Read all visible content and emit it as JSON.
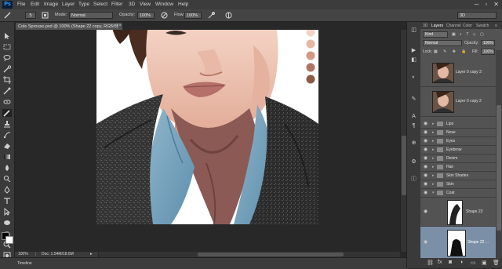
{
  "app": {
    "logo": "Ps"
  },
  "menu": [
    "File",
    "Edit",
    "Image",
    "Layer",
    "Type",
    "Select",
    "Filter",
    "3D",
    "View",
    "Window",
    "Help"
  ],
  "window_controls": [
    "─",
    "▫",
    "✕"
  ],
  "options_bar": {
    "size_value": "5",
    "mode_label": "Mode:",
    "mode_value": "Normal",
    "opacity_label": "Opacity:",
    "opacity_value": "100%",
    "flow_label": "Flow:",
    "flow_value": "100%",
    "workspace_value": "3D"
  },
  "document": {
    "tab_title": "Cole Sprouse.psd @ 100% (Shape 22 copy, RGB/8) *",
    "close_glyph": "×",
    "zoom": "100%",
    "doc_size": "Doc: 1.54M/18.6M"
  },
  "timeline": {
    "label": "Timeline"
  },
  "swatches": [
    "#f2d3c7",
    "#e8b7a4",
    "#d49884",
    "#b07461",
    "#8b5a47"
  ],
  "layers_panel": {
    "tabs": [
      "3D",
      "Layers",
      "Channel",
      "Color",
      "Swatch"
    ],
    "active_tab": "Layers",
    "filter_value": "Kind",
    "blend_mode": "Normal",
    "opacity_label": "Opacity:",
    "opacity_value": "100%",
    "lock_label": "Lock:",
    "fill_label": "Fill:",
    "fill_value": "100%",
    "layers": [
      {
        "name": "Layer 0 copy 3",
        "kind": "photo",
        "visible": false
      },
      {
        "name": "Layer 0 copy 2",
        "kind": "photo",
        "visible": false
      },
      {
        "name": "Lips",
        "kind": "group",
        "visible": true
      },
      {
        "name": "Nose",
        "kind": "group",
        "visible": true
      },
      {
        "name": "Eyes",
        "kind": "group",
        "visible": true
      },
      {
        "name": "Eyebrow",
        "kind": "group",
        "visible": true
      },
      {
        "name": "Denim",
        "kind": "group",
        "visible": true
      },
      {
        "name": "Hair",
        "kind": "group",
        "visible": true
      },
      {
        "name": "Skin Shades",
        "kind": "group",
        "visible": true
      },
      {
        "name": "Skin",
        "kind": "group",
        "visible": true
      },
      {
        "name": "Coat",
        "kind": "group-open",
        "visible": true
      },
      {
        "name": "Shape 23",
        "kind": "shape",
        "visible": true
      },
      {
        "name": "Shape 22 ...",
        "kind": "shape-selected",
        "visible": true
      }
    ]
  }
}
